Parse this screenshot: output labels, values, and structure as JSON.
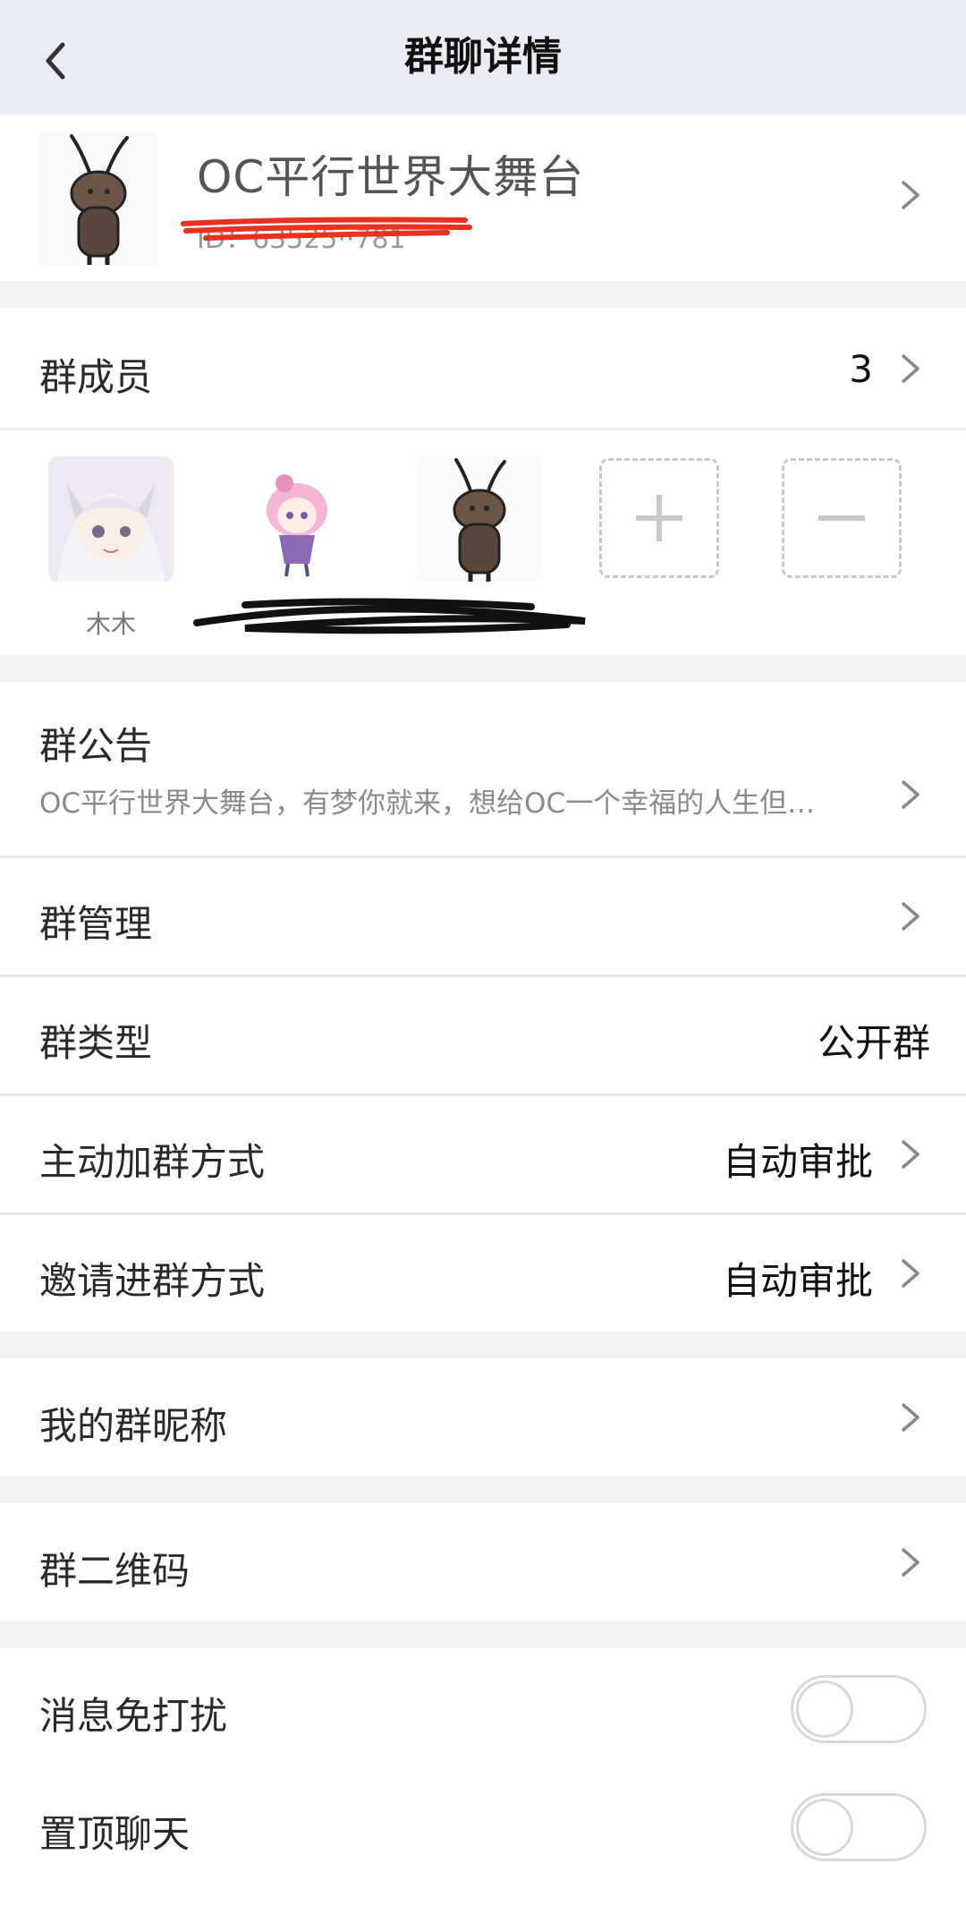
{
  "header": {
    "title": "群聊详情",
    "back_icon": "chevron-left-icon"
  },
  "group": {
    "name": "OC平行世界大舞台",
    "id_text": "ID：63525··781"
  },
  "members": {
    "label": "群成员",
    "count": "3",
    "items": [
      {
        "name": "木木"
      },
      {
        "name": ""
      },
      {
        "name": ""
      }
    ]
  },
  "announcement": {
    "label": "群公告",
    "text": "OC平行世界大舞台，有梦你就来，想给OC一个幸福的人生但…"
  },
  "rows": {
    "management": "群管理",
    "type_label": "群类型",
    "type_value": "公开群",
    "join_label": "主动加群方式",
    "join_value": "自动审批",
    "invite_label": "邀请进群方式",
    "invite_value": "自动审批",
    "nickname": "我的群昵称",
    "qrcode": "群二维码",
    "mute": "消息免打扰",
    "pin": "置顶聊天"
  },
  "toggles": {
    "mute": false,
    "pin": false
  },
  "colors": {
    "nav_bg": "#e9edf3",
    "page_bg": "#f2f3f5",
    "redaction_red": "#e8311f",
    "redaction_black": "#111111"
  }
}
